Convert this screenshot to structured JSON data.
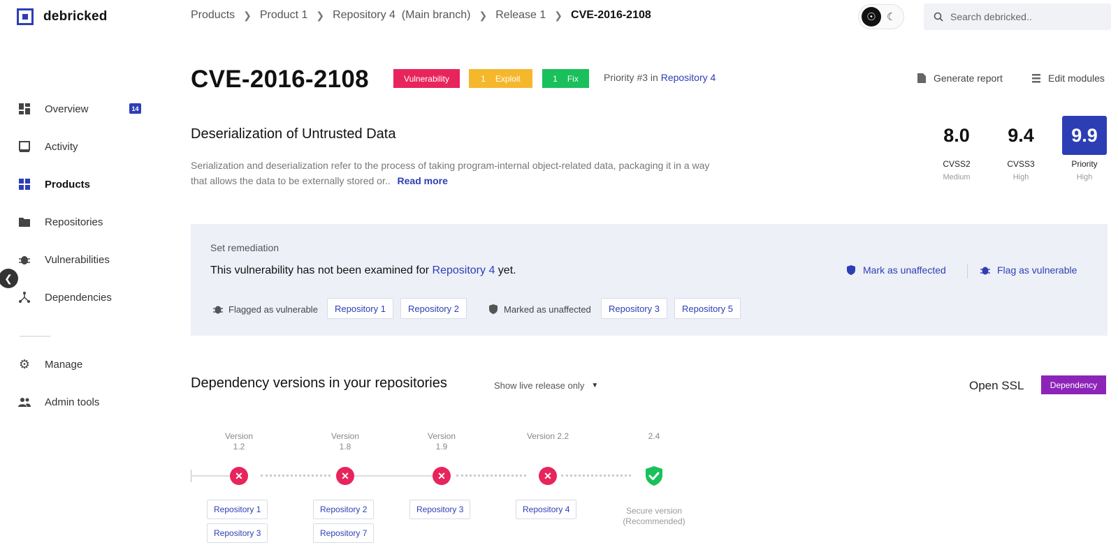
{
  "app": {
    "name": "debricked"
  },
  "breadcrumb": [
    "Products",
    "Product 1",
    "Repository 4  (Main branch)",
    "Release 1",
    "CVE-2016-2108"
  ],
  "search": {
    "placeholder": "Search debricked.."
  },
  "sidebar": {
    "items": [
      {
        "label": "Overview",
        "icon": "overview-icon",
        "badge": "14"
      },
      {
        "label": "Activity",
        "icon": "activity-icon"
      },
      {
        "label": "Products",
        "icon": "products-icon",
        "active": true
      },
      {
        "label": "Repositories",
        "icon": "folder-icon"
      },
      {
        "label": "Vulnerabilities",
        "icon": "bug-icon"
      },
      {
        "label": "Dependencies",
        "icon": "dependencies-icon"
      },
      {
        "label": "Manage",
        "icon": "gear-icon"
      },
      {
        "label": "Admin tools",
        "icon": "users-icon"
      }
    ]
  },
  "header": {
    "title": "CVE-2016-2108",
    "tags": {
      "vulnerability": "Vulnerability",
      "exploit_count": "1",
      "exploit_label": "Exploit",
      "fix_count": "1",
      "fix_label": "Fix"
    },
    "priority_prefix": "Priority #3 in",
    "priority_link": "Repository 4",
    "actions": {
      "generate_report": "Generate report",
      "edit_modules": "Edit modules"
    }
  },
  "vulnerability": {
    "name": "Deserialization of Untrusted Data",
    "description": "Serialization and deserialization refer to the process of taking program-internal object-related data, packaging it in a way that allows the data to be externally stored or..",
    "read_more": "Read more"
  },
  "scores": [
    {
      "value": "8.0",
      "label": "CVSS2",
      "severity": "Medium"
    },
    {
      "value": "9.4",
      "label": "CVSS3",
      "severity": "High"
    },
    {
      "value": "9.9",
      "label": "Priority",
      "severity": "High"
    }
  ],
  "remediation": {
    "title": "Set remediation",
    "message_prefix": "This vulnerability has not been examined for",
    "message_link": "Repository 4",
    "message_suffix": "yet.",
    "mark_unaffected": "Mark as unaffected",
    "flag_vulnerable": "Flag as vulnerable",
    "flagged_label": "Flagged as vulnerable",
    "flagged_repos": [
      "Repository 1",
      "Repository 2"
    ],
    "marked_label": "Marked as unaffected",
    "marked_repos": [
      "Repository 3",
      "Repository 5"
    ]
  },
  "dependencies": {
    "title": "Dependency versions in your repositories",
    "filter": "Show live release only",
    "dependency_name": "Open SSL",
    "dependency_tag": "Dependency",
    "versions": [
      {
        "label_1": "Version",
        "label_2": "1.2",
        "status": "vulnerable",
        "repos": [
          "Repository 1",
          "Repository 3"
        ]
      },
      {
        "label_1": "Version",
        "label_2": "1.8",
        "status": "vulnerable",
        "repos": [
          "Repository 2",
          "Repository 7"
        ]
      },
      {
        "label_1": "Version",
        "label_2": "1.9",
        "status": "vulnerable",
        "repos": [
          "Repository 3"
        ]
      },
      {
        "label_1": "Version 2.2",
        "label_2": "",
        "status": "vulnerable",
        "repos": [
          "Repository 4"
        ]
      },
      {
        "label_1": "2.4",
        "label_2": "",
        "status": "secure",
        "secure_1": "Secure version",
        "secure_2": "(Recommended)"
      }
    ]
  },
  "colors": {
    "brand": "#2d3eb5",
    "vulnerability": "#e8245c",
    "exploit": "#f5b72c",
    "fix": "#19c05b",
    "dependency": "#8d24b8",
    "panel": "#eef0f8"
  }
}
